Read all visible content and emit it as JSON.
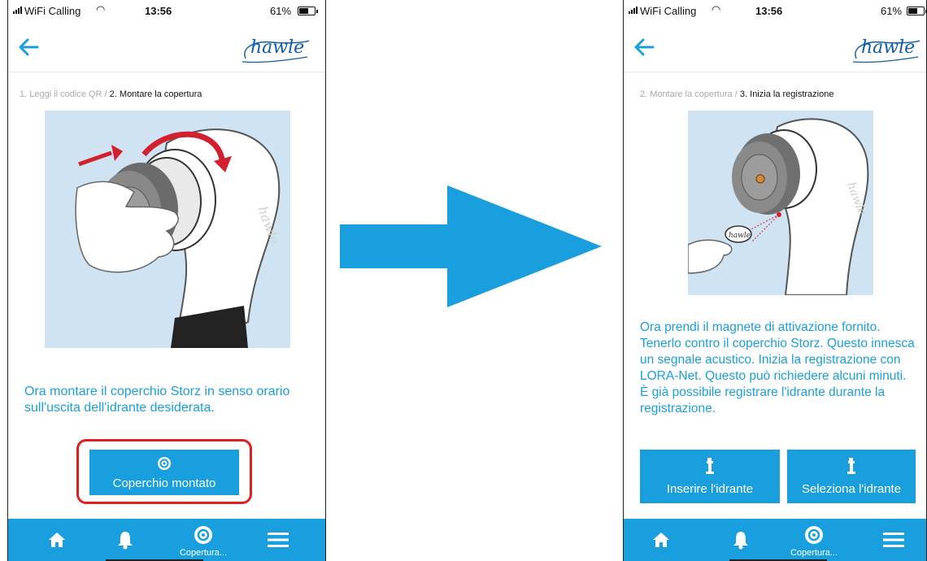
{
  "brand": {
    "logo_text": "hawle",
    "accent": "#1a9fde",
    "logo_color": "#0e5fa6",
    "highlight": "#e02020"
  },
  "left_screen": {
    "status": {
      "carrier": "WiFi Calling",
      "time": "13:56",
      "battery": "61%",
      "battery_level": 0.61
    },
    "breadcrumb": {
      "previous": "1. Leggi il codice QR",
      "separator": " / ",
      "current": "2. Montare la copertura"
    },
    "instruction": "Ora montare il coperchio Storz in senso orario sull'uscita dell'idrante desiderata.",
    "action_button": {
      "label": "Coperchio montato",
      "icon": "cover-icon",
      "highlighted": true
    },
    "tabbar": [
      {
        "icon": "home-icon",
        "label": ""
      },
      {
        "icon": "bell-icon",
        "label": ""
      },
      {
        "icon": "cover-icon",
        "label": "Copertura..."
      },
      {
        "icon": "menu-icon",
        "label": ""
      }
    ]
  },
  "right_screen": {
    "status": {
      "carrier": "WiFi Calling",
      "time": "13:56",
      "battery": "61%",
      "battery_level": 0.61
    },
    "breadcrumb": {
      "previous": "2. Montare la copertura",
      "separator": " / ",
      "current": "3. Inizia la registrazione"
    },
    "instruction": "Ora prendi il magnete di attivazione fornito. Tenerlo contro il coperchio Storz. Questo innesca un segnale acustico. Inizia la registrazione con LORA-Net. Questo può richiedere alcuni minuti. È già possibile registrare l'idrante durante la registrazione.",
    "buttons": [
      {
        "label": "Inserire l'idrante",
        "icon": "hydrant-icon"
      },
      {
        "label": "Seleziona l'idrante",
        "icon": "hydrant-icon"
      }
    ],
    "tabbar": [
      {
        "icon": "home-icon",
        "label": ""
      },
      {
        "icon": "bell-icon",
        "label": ""
      },
      {
        "icon": "cover-icon",
        "label": "Copertura..."
      },
      {
        "icon": "menu-icon",
        "label": ""
      }
    ]
  },
  "flow_arrow": {
    "icon": "right-arrow-icon",
    "color": "#1a9fde"
  }
}
